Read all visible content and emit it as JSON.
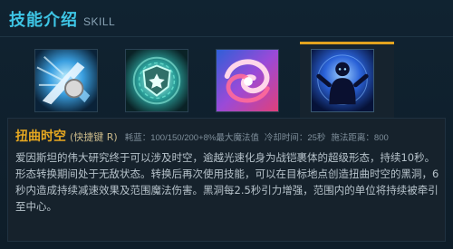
{
  "header": {
    "title": "技能介绍",
    "subtitle": "SKILL"
  },
  "skills": [
    {
      "name": "skill-1",
      "icon": "blade-impact-icon",
      "accent": "#4ab8f0"
    },
    {
      "name": "skill-2",
      "icon": "shield-star-icon",
      "accent": "#3fd0c0"
    },
    {
      "name": "skill-3",
      "icon": "swirl-vortex-icon",
      "accent": "#e04a8a"
    },
    {
      "name": "skill-4",
      "icon": "silhouette-burst-icon",
      "accent": "#3a7cff",
      "selected": true
    }
  ],
  "detail": {
    "name": "扭曲时空",
    "hotkey": "(快捷键 R)",
    "cost": "耗蓝：100/150/200+8%最大魔法值",
    "cooldown": "冷却时间：25秒",
    "range": "施法距离：800",
    "description": "爱因斯坦的伟大研究终于可以涉及时空，逾越光速化身为战铠裹体的超级形态，持续10秒。形态转换期间处于无敌状态。转换后再次使用技能，可以在目标地点创造扭曲时空的黑洞，6秒内造成持续减速效果及范围魔法伤害。黑洞每2.5秒引力增强，范围内的单位将持续被牵引至中心。"
  },
  "colors": {
    "title": "#3ec6e6",
    "skill_name": "#e6a821",
    "selected_bar": "#e2a21f",
    "text": "#b7c3cb"
  }
}
